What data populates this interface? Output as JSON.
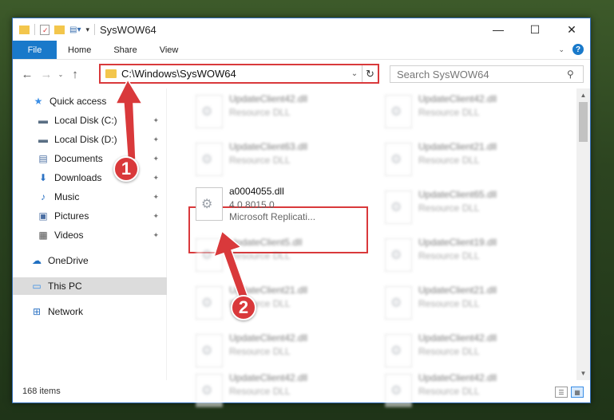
{
  "window": {
    "title": "SysWOW64",
    "controls": {
      "minimize": "—",
      "maximize": "☐",
      "close": "✕"
    }
  },
  "ribbon": {
    "tabs": [
      "File",
      "Home",
      "Share",
      "View"
    ],
    "help": "?"
  },
  "address": {
    "path": "C:\\Windows\\SysWOW64",
    "refresh_glyph": "↻",
    "dropdown_glyph": "⌄"
  },
  "search": {
    "placeholder": "Search SysWOW64"
  },
  "nav": {
    "items": [
      {
        "label": "Quick access",
        "icon": "star-icon",
        "glyph": "★",
        "color": "#3a8ee6"
      },
      {
        "label": "Local Disk (C:)",
        "icon": "drive-icon",
        "glyph": "▬",
        "color": "#5a6f84",
        "pinned": true
      },
      {
        "label": "Local Disk (D:)",
        "icon": "drive-icon",
        "glyph": "▬",
        "color": "#5a6f84",
        "pinned": true
      },
      {
        "label": "Documents",
        "icon": "document-icon",
        "glyph": "▤",
        "color": "#4b6fa3",
        "pinned": true
      },
      {
        "label": "Downloads",
        "icon": "download-icon",
        "glyph": "⬇",
        "color": "#2d73c4",
        "pinned": true
      },
      {
        "label": "Music",
        "icon": "music-icon",
        "glyph": "♪",
        "color": "#2d73c4",
        "pinned": true
      },
      {
        "label": "Pictures",
        "icon": "pictures-icon",
        "glyph": "▣",
        "color": "#4b6fa3",
        "pinned": true
      },
      {
        "label": "Videos",
        "icon": "videos-icon",
        "glyph": "▦",
        "color": "#4b4b4b",
        "pinned": true
      },
      {
        "label": "OneDrive",
        "icon": "cloud-icon",
        "glyph": "☁",
        "color": "#1f6fc1"
      },
      {
        "label": "This PC",
        "icon": "computer-icon",
        "glyph": "▭",
        "color": "#3a8ee6",
        "selected": true
      },
      {
        "label": "Network",
        "icon": "network-icon",
        "glyph": "⊞",
        "color": "#2d73c4"
      }
    ],
    "pin_glyph": "📌"
  },
  "files": {
    "items": [
      {
        "name": "UpdateClient42.dll",
        "sub": "Resource DLL",
        "blurred": true
      },
      {
        "name": "UpdateClient42.dll",
        "sub": "Resource DLL",
        "blurred": true
      },
      {
        "name": "UpdateClient63.dll",
        "sub": "Resource DLL",
        "blurred": true
      },
      {
        "name": "UpdateClient21.dll",
        "sub": "Resource DLL",
        "blurred": true
      },
      {
        "name": "a0004055.dll",
        "sub": "4.0.8015.0",
        "sub2": "Microsoft Replicati...",
        "blurred": false
      },
      {
        "name": "UpdateClient65.dll",
        "sub": "Resource DLL",
        "blurred": true
      },
      {
        "name": "UpdateClient5.dll",
        "sub": "Resource DLL",
        "blurred": true
      },
      {
        "name": "UpdateClient19.dll",
        "sub": "Resource DLL",
        "blurred": true
      },
      {
        "name": "UpdateClient21.dll",
        "sub": "Resource DLL",
        "blurred": true
      },
      {
        "name": "UpdateClient21.dll",
        "sub": "Resource DLL",
        "blurred": true
      },
      {
        "name": "UpdateClient42.dll",
        "sub": "Resource DLL",
        "blurred": true
      },
      {
        "name": "UpdateClient42.dll",
        "sub": "Resource DLL",
        "blurred": true
      },
      {
        "name": "UpdateClient42.dll",
        "sub": "Resource DLL",
        "blurred": true
      },
      {
        "name": "UpdateClient42.dll",
        "sub": "Resource DLL",
        "blurred": true
      }
    ]
  },
  "status": {
    "count": "168 items"
  },
  "annotations": {
    "step1": "1",
    "step2": "2",
    "color": "#d9393b"
  }
}
